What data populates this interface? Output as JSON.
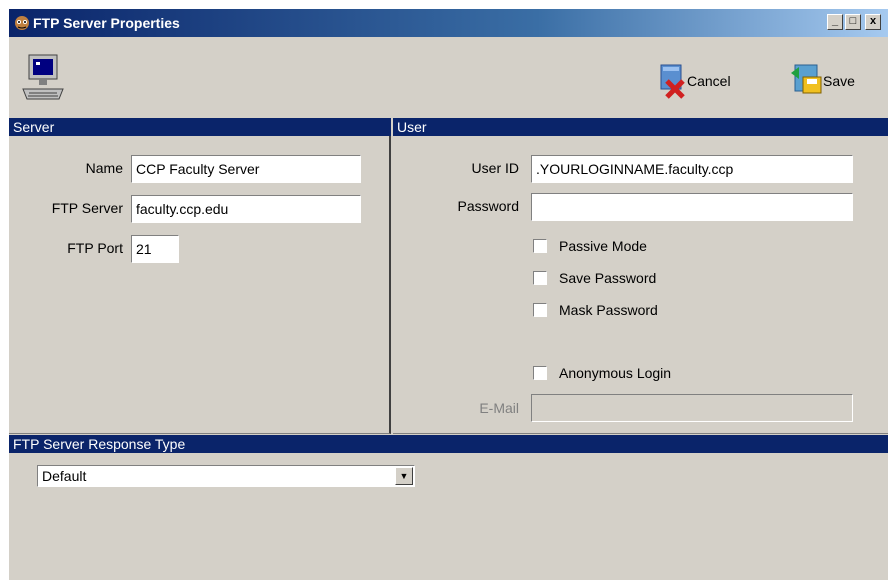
{
  "window": {
    "title": "FTP Server Properties",
    "controls": {
      "minimize": "_",
      "maximize": "□",
      "close": "x"
    }
  },
  "toolbar": {
    "cancel_label": "Cancel",
    "save_label": "Save",
    "icons": {
      "server": "computer-icon",
      "cancel": "cancel-icon",
      "save": "save-icon"
    }
  },
  "server_panel": {
    "header": "Server",
    "name_label": "Name",
    "name_value": "CCP Faculty Server",
    "ftp_server_label": "FTP Server",
    "ftp_server_value": "faculty.ccp.edu",
    "ftp_port_label": "FTP Port",
    "ftp_port_value": "21"
  },
  "user_panel": {
    "header": "User",
    "user_id_label": "User ID",
    "user_id_value": ".YOURLOGINNAME.faculty.ccp",
    "password_label": "Password",
    "password_value": "",
    "passive_mode_label": "Passive Mode",
    "save_password_label": "Save Password",
    "mask_password_label": "Mask Password",
    "anonymous_login_label": "Anonymous Login",
    "email_label": "E-Mail",
    "email_value": ""
  },
  "response_panel": {
    "header": "FTP Server Response Type",
    "selected": "Default"
  },
  "colors": {
    "panel_header": "#0a246a",
    "window_bg": "#d4d0c8"
  }
}
